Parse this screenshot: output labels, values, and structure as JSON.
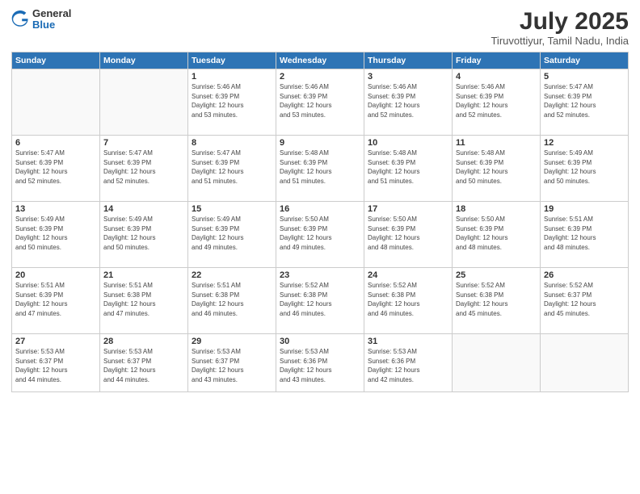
{
  "logo": {
    "general": "General",
    "blue": "Blue"
  },
  "header": {
    "month": "July 2025",
    "location": "Tiruvottiyur, Tamil Nadu, India"
  },
  "weekdays": [
    "Sunday",
    "Monday",
    "Tuesday",
    "Wednesday",
    "Thursday",
    "Friday",
    "Saturday"
  ],
  "weeks": [
    [
      {
        "day": "",
        "info": ""
      },
      {
        "day": "",
        "info": ""
      },
      {
        "day": "1",
        "info": "Sunrise: 5:46 AM\nSunset: 6:39 PM\nDaylight: 12 hours\nand 53 minutes."
      },
      {
        "day": "2",
        "info": "Sunrise: 5:46 AM\nSunset: 6:39 PM\nDaylight: 12 hours\nand 53 minutes."
      },
      {
        "day": "3",
        "info": "Sunrise: 5:46 AM\nSunset: 6:39 PM\nDaylight: 12 hours\nand 52 minutes."
      },
      {
        "day": "4",
        "info": "Sunrise: 5:46 AM\nSunset: 6:39 PM\nDaylight: 12 hours\nand 52 minutes."
      },
      {
        "day": "5",
        "info": "Sunrise: 5:47 AM\nSunset: 6:39 PM\nDaylight: 12 hours\nand 52 minutes."
      }
    ],
    [
      {
        "day": "6",
        "info": "Sunrise: 5:47 AM\nSunset: 6:39 PM\nDaylight: 12 hours\nand 52 minutes."
      },
      {
        "day": "7",
        "info": "Sunrise: 5:47 AM\nSunset: 6:39 PM\nDaylight: 12 hours\nand 52 minutes."
      },
      {
        "day": "8",
        "info": "Sunrise: 5:47 AM\nSunset: 6:39 PM\nDaylight: 12 hours\nand 51 minutes."
      },
      {
        "day": "9",
        "info": "Sunrise: 5:48 AM\nSunset: 6:39 PM\nDaylight: 12 hours\nand 51 minutes."
      },
      {
        "day": "10",
        "info": "Sunrise: 5:48 AM\nSunset: 6:39 PM\nDaylight: 12 hours\nand 51 minutes."
      },
      {
        "day": "11",
        "info": "Sunrise: 5:48 AM\nSunset: 6:39 PM\nDaylight: 12 hours\nand 50 minutes."
      },
      {
        "day": "12",
        "info": "Sunrise: 5:49 AM\nSunset: 6:39 PM\nDaylight: 12 hours\nand 50 minutes."
      }
    ],
    [
      {
        "day": "13",
        "info": "Sunrise: 5:49 AM\nSunset: 6:39 PM\nDaylight: 12 hours\nand 50 minutes."
      },
      {
        "day": "14",
        "info": "Sunrise: 5:49 AM\nSunset: 6:39 PM\nDaylight: 12 hours\nand 50 minutes."
      },
      {
        "day": "15",
        "info": "Sunrise: 5:49 AM\nSunset: 6:39 PM\nDaylight: 12 hours\nand 49 minutes."
      },
      {
        "day": "16",
        "info": "Sunrise: 5:50 AM\nSunset: 6:39 PM\nDaylight: 12 hours\nand 49 minutes."
      },
      {
        "day": "17",
        "info": "Sunrise: 5:50 AM\nSunset: 6:39 PM\nDaylight: 12 hours\nand 48 minutes."
      },
      {
        "day": "18",
        "info": "Sunrise: 5:50 AM\nSunset: 6:39 PM\nDaylight: 12 hours\nand 48 minutes."
      },
      {
        "day": "19",
        "info": "Sunrise: 5:51 AM\nSunset: 6:39 PM\nDaylight: 12 hours\nand 48 minutes."
      }
    ],
    [
      {
        "day": "20",
        "info": "Sunrise: 5:51 AM\nSunset: 6:39 PM\nDaylight: 12 hours\nand 47 minutes."
      },
      {
        "day": "21",
        "info": "Sunrise: 5:51 AM\nSunset: 6:38 PM\nDaylight: 12 hours\nand 47 minutes."
      },
      {
        "day": "22",
        "info": "Sunrise: 5:51 AM\nSunset: 6:38 PM\nDaylight: 12 hours\nand 46 minutes."
      },
      {
        "day": "23",
        "info": "Sunrise: 5:52 AM\nSunset: 6:38 PM\nDaylight: 12 hours\nand 46 minutes."
      },
      {
        "day": "24",
        "info": "Sunrise: 5:52 AM\nSunset: 6:38 PM\nDaylight: 12 hours\nand 46 minutes."
      },
      {
        "day": "25",
        "info": "Sunrise: 5:52 AM\nSunset: 6:38 PM\nDaylight: 12 hours\nand 45 minutes."
      },
      {
        "day": "26",
        "info": "Sunrise: 5:52 AM\nSunset: 6:37 PM\nDaylight: 12 hours\nand 45 minutes."
      }
    ],
    [
      {
        "day": "27",
        "info": "Sunrise: 5:53 AM\nSunset: 6:37 PM\nDaylight: 12 hours\nand 44 minutes."
      },
      {
        "day": "28",
        "info": "Sunrise: 5:53 AM\nSunset: 6:37 PM\nDaylight: 12 hours\nand 44 minutes."
      },
      {
        "day": "29",
        "info": "Sunrise: 5:53 AM\nSunset: 6:37 PM\nDaylight: 12 hours\nand 43 minutes."
      },
      {
        "day": "30",
        "info": "Sunrise: 5:53 AM\nSunset: 6:36 PM\nDaylight: 12 hours\nand 43 minutes."
      },
      {
        "day": "31",
        "info": "Sunrise: 5:53 AM\nSunset: 6:36 PM\nDaylight: 12 hours\nand 42 minutes."
      },
      {
        "day": "",
        "info": ""
      },
      {
        "day": "",
        "info": ""
      }
    ]
  ]
}
